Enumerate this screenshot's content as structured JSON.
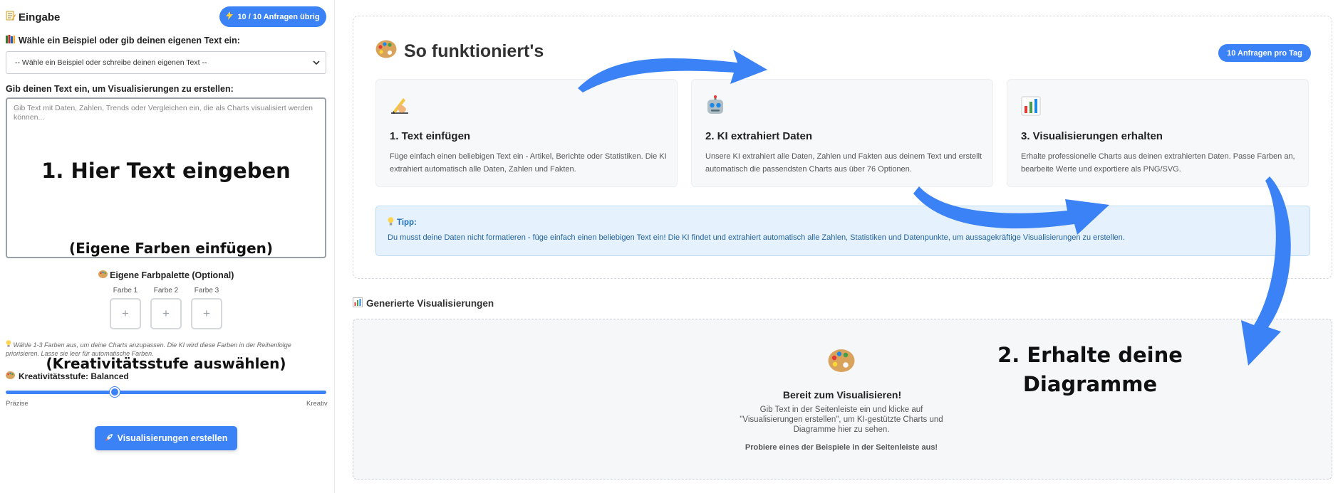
{
  "sidebar": {
    "title": "Eingabe",
    "quota_badge": "10 / 10 Anfragen übrig",
    "example_label": "Wähle ein Beispiel oder gib deinen eigenen Text ein:",
    "example_select_value": "-- Wähle ein Beispiel oder schreibe deinen eigenen Text --",
    "text_label": "Gib deinen Text ein, um Visualisierungen zu erstellen:",
    "text_placeholder": "Gib Text mit Daten, Zahlen, Trends oder Vergleichen ein, die als Charts visualisiert werden können...",
    "palette_title": "Eigene Farbpalette (Optional)",
    "swatches": [
      "Farbe 1",
      "Farbe 2",
      "Farbe 3"
    ],
    "swatch_add": "+",
    "palette_hint": "Wähle 1-3 Farben aus, um deine Charts anzupassen. Die KI wird diese Farben in der Reihenfolge priorisieren. Lasse sie leer für automatische Farben.",
    "creativity_label": "Kreativitätsstufe: Balanced",
    "creativity_level": 0.34,
    "slider_min_label": "Präzise",
    "slider_max_label": "Kreativ",
    "create_button": "Visualisierungen erstellen"
  },
  "annotations": {
    "enter_text": "1. Hier Text eingeben",
    "own_colors": "(Eigene Farben einfügen)",
    "creativity": "(Kreativitätsstufe auswählen)",
    "get_charts_1": "2. Erhalte deine",
    "get_charts_2": "Diagramme"
  },
  "how": {
    "title": "So funktioniert's",
    "pill": "10 Anfragen pro Tag",
    "steps": [
      {
        "title": "1. Text einfügen",
        "desc": "Füge einfach einen beliebigen Text ein - Artikel, Berichte oder Statistiken. Die KI extrahiert automatisch alle Daten, Zahlen und Fakten."
      },
      {
        "title": "2. KI extrahiert Daten",
        "desc": "Unsere KI extrahiert alle Daten, Zahlen und Fakten aus deinem Text und erstellt automatisch die passendsten Charts aus über 76 Optionen."
      },
      {
        "title": "3. Visualisierungen erhalten",
        "desc": "Erhalte professionelle Charts aus deinen extrahierten Daten. Passe Farben an, bearbeite Werte und exportiere als PNG/SVG."
      }
    ],
    "tip_title": "Tipp:",
    "tip_text": "Du musst deine Daten nicht formatieren - füge einfach einen beliebigen Text ein! Die KI findet und extrahiert automatisch alle Zahlen, Statistiken und Datenpunkte, um aussagekräftige Visualisierungen zu erstellen."
  },
  "generated": {
    "title": "Generierte Visualisierungen",
    "empty_title": "Bereit zum Visualisieren!",
    "empty_desc": "Gib Text in der Seitenleiste ein und klicke auf \"Visualisierungen erstellen\", um KI-gestützte Charts und Diagramme hier zu sehen.",
    "empty_try": "Probiere eines der Beispiele in der Seitenleiste aus!"
  },
  "icons": {
    "sidebar_title": "memo-icon",
    "quota": "lightning-icon",
    "example": "books-icon",
    "palette": "palette-icon",
    "creativity": "palette-icon",
    "create": "rocket-icon",
    "how": "palette-icon",
    "step1": "writing-hand-icon",
    "step2": "robot-icon",
    "step3": "bar-chart-icon",
    "tip": "lightbulb-icon",
    "generated": "bar-chart-icon"
  },
  "colors": {
    "accent": "#3b82f6",
    "arrow": "#3b82f6",
    "tip_bg": "#e5f2fd",
    "tip_text": "#1f5f9c"
  }
}
